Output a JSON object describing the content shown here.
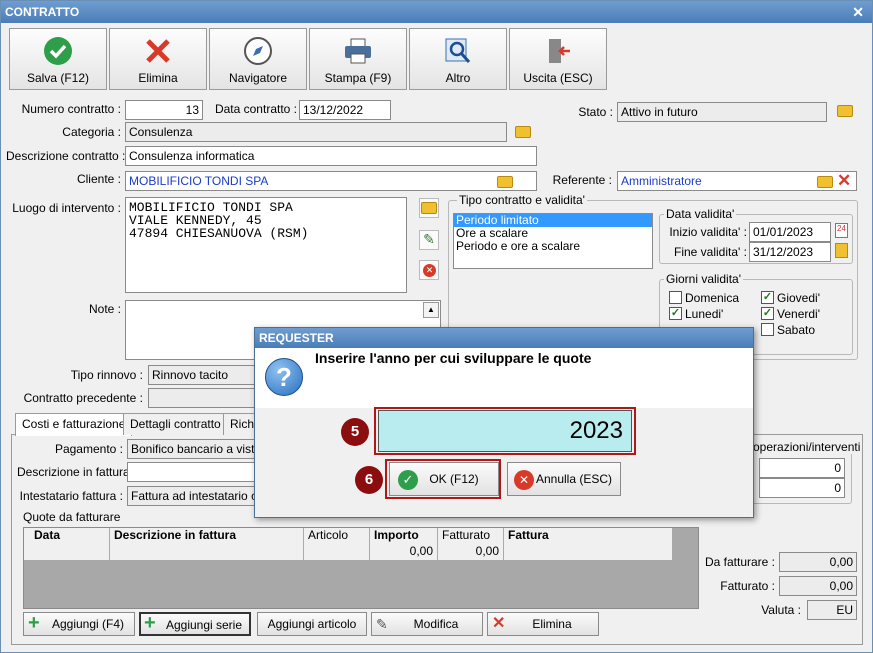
{
  "window": {
    "title": "CONTRATTO"
  },
  "toolbar": {
    "save": "Salva (F12)",
    "delete": "Elimina",
    "navigator": "Navigatore",
    "print": "Stampa (F9)",
    "other": "Altro",
    "exit": "Uscita (ESC)"
  },
  "form": {
    "numero_label": "Numero contratto :",
    "numero_value": "13",
    "data_label": "Data contratto :",
    "data_value": "13/12/2022",
    "stato_label": "Stato :",
    "stato_value": "Attivo in futuro",
    "categoria_label": "Categoria :",
    "categoria_value": "Consulenza",
    "descrizione_label": "Descrizione contratto :",
    "descrizione_value": "Consulenza informatica",
    "cliente_label": "Cliente :",
    "cliente_value": "MOBILIFICIO TONDI SPA",
    "referente_label": "Referente :",
    "referente_value": "Amministratore",
    "luogo_label": "Luogo di intervento :",
    "luogo_lines": [
      "MOBILIFICIO TONDI SPA",
      "VIALE KENNEDY, 45",
      "47894 CHIESANUOVA (RSM)"
    ],
    "note_label": "Note :",
    "tipo_rinnovo_label": "Tipo rinnovo :",
    "tipo_rinnovo_value": "Rinnovo tacito",
    "contratto_prec_label": "Contratto precedente :"
  },
  "tipo_contratto": {
    "title": "Tipo contratto e validita'",
    "options": [
      "Periodo limitato",
      "Ore a scalare",
      "Periodo e ore a scalare"
    ],
    "selected": "Periodo limitato"
  },
  "data_validita": {
    "title": "Data validita'",
    "inizio_label": "Inizio validita' :",
    "inizio_value": "01/01/2023",
    "fine_label": "Fine validita' :",
    "fine_value": "31/12/2023"
  },
  "giorni": {
    "title": "Giorni validita'",
    "domenica": "Domenica",
    "lunedi": "Lunedi'",
    "giovedi": "Giovedi'",
    "venerdi": "Venerdi'",
    "sabato": "Sabato"
  },
  "tabs": [
    "Costi e fatturazione",
    "Dettagli contratto",
    "Richi"
  ],
  "costi": {
    "pagamento_label": "Pagamento :",
    "pagamento_value": "Bonifico bancario a vista",
    "descr_fatt_label": "Descrizione in fattura",
    "intestatario_label": "Intestatario fattura :",
    "intestatario_value": "Fattura ad intestatario co",
    "operazioni_label": "operazioni/interventi",
    "op_value1": "0",
    "op_value2": "0",
    "quote_label": "Quote da fatturare",
    "columns": [
      "Data",
      "Descrizione in fattura",
      "Articolo",
      "Importo",
      "Fatturato",
      "Fattura"
    ],
    "row": {
      "importo": "0,00",
      "fatturato": "0,00"
    },
    "da_fatturare_label": "Da fatturare :",
    "da_fatturare_value": "0,00",
    "fatturato_label": "Fatturato :",
    "fatturato_value": "0,00",
    "valuta_label": "Valuta :",
    "valuta_value": "EU"
  },
  "bottom_buttons": {
    "aggiungi": "Aggiungi (F4)",
    "aggiungi_serie": "Aggiungi serie",
    "aggiungi_articolo": "Aggiungi articolo",
    "modifica": "Modifica",
    "elimina": "Elimina"
  },
  "dialog": {
    "title": "REQUESTER",
    "message": "Inserire l'anno per cui sviluppare le quote",
    "value": "2023",
    "ok": "OK (F12)",
    "cancel": "Annulla (ESC)"
  },
  "markers": {
    "m5": "5",
    "m6": "6"
  },
  "colors": {
    "titlebar": "#5a8bc4",
    "input_highlight": "#b8ecef",
    "marker": "#8b0d0d"
  }
}
